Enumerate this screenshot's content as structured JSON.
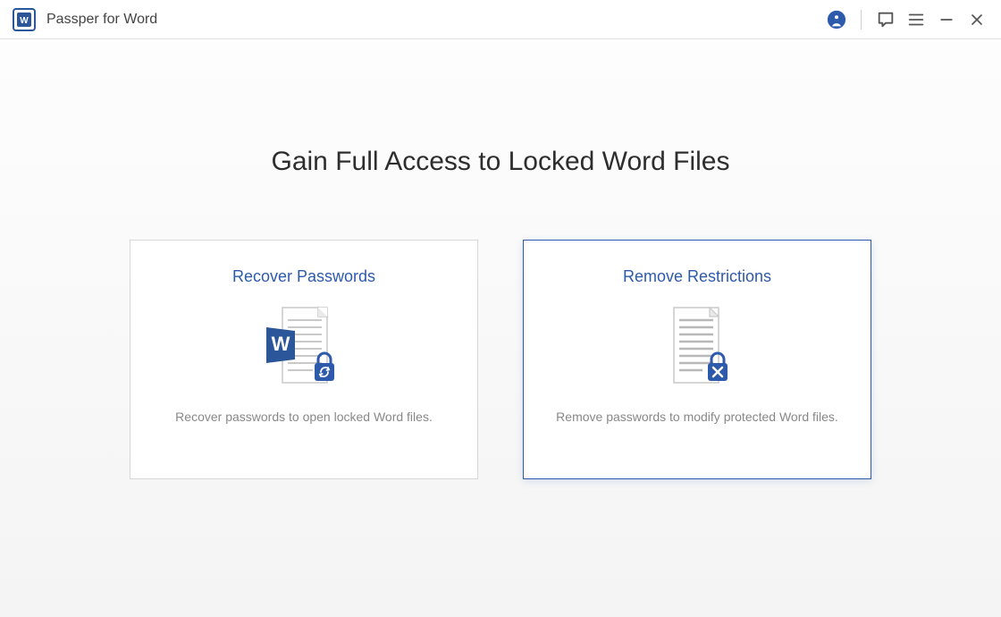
{
  "app": {
    "title": "Passper for Word"
  },
  "toolbar": {
    "account_icon": "account",
    "feedback_icon": "feedback",
    "menu_icon": "menu",
    "minimize_icon": "minimize",
    "close_icon": "close"
  },
  "main": {
    "title": "Gain Full Access to Locked Word Files"
  },
  "cards": [
    {
      "id": "recover",
      "title": "Recover Passwords",
      "desc": "Recover passwords to open locked Word files.",
      "selected": false
    },
    {
      "id": "remove",
      "title": "Remove Restrictions",
      "desc": "Remove passwords to modify protected Word files.",
      "selected": true
    }
  ],
  "colors": {
    "accent": "#2e5aac",
    "word_blue": "#2b579a"
  }
}
